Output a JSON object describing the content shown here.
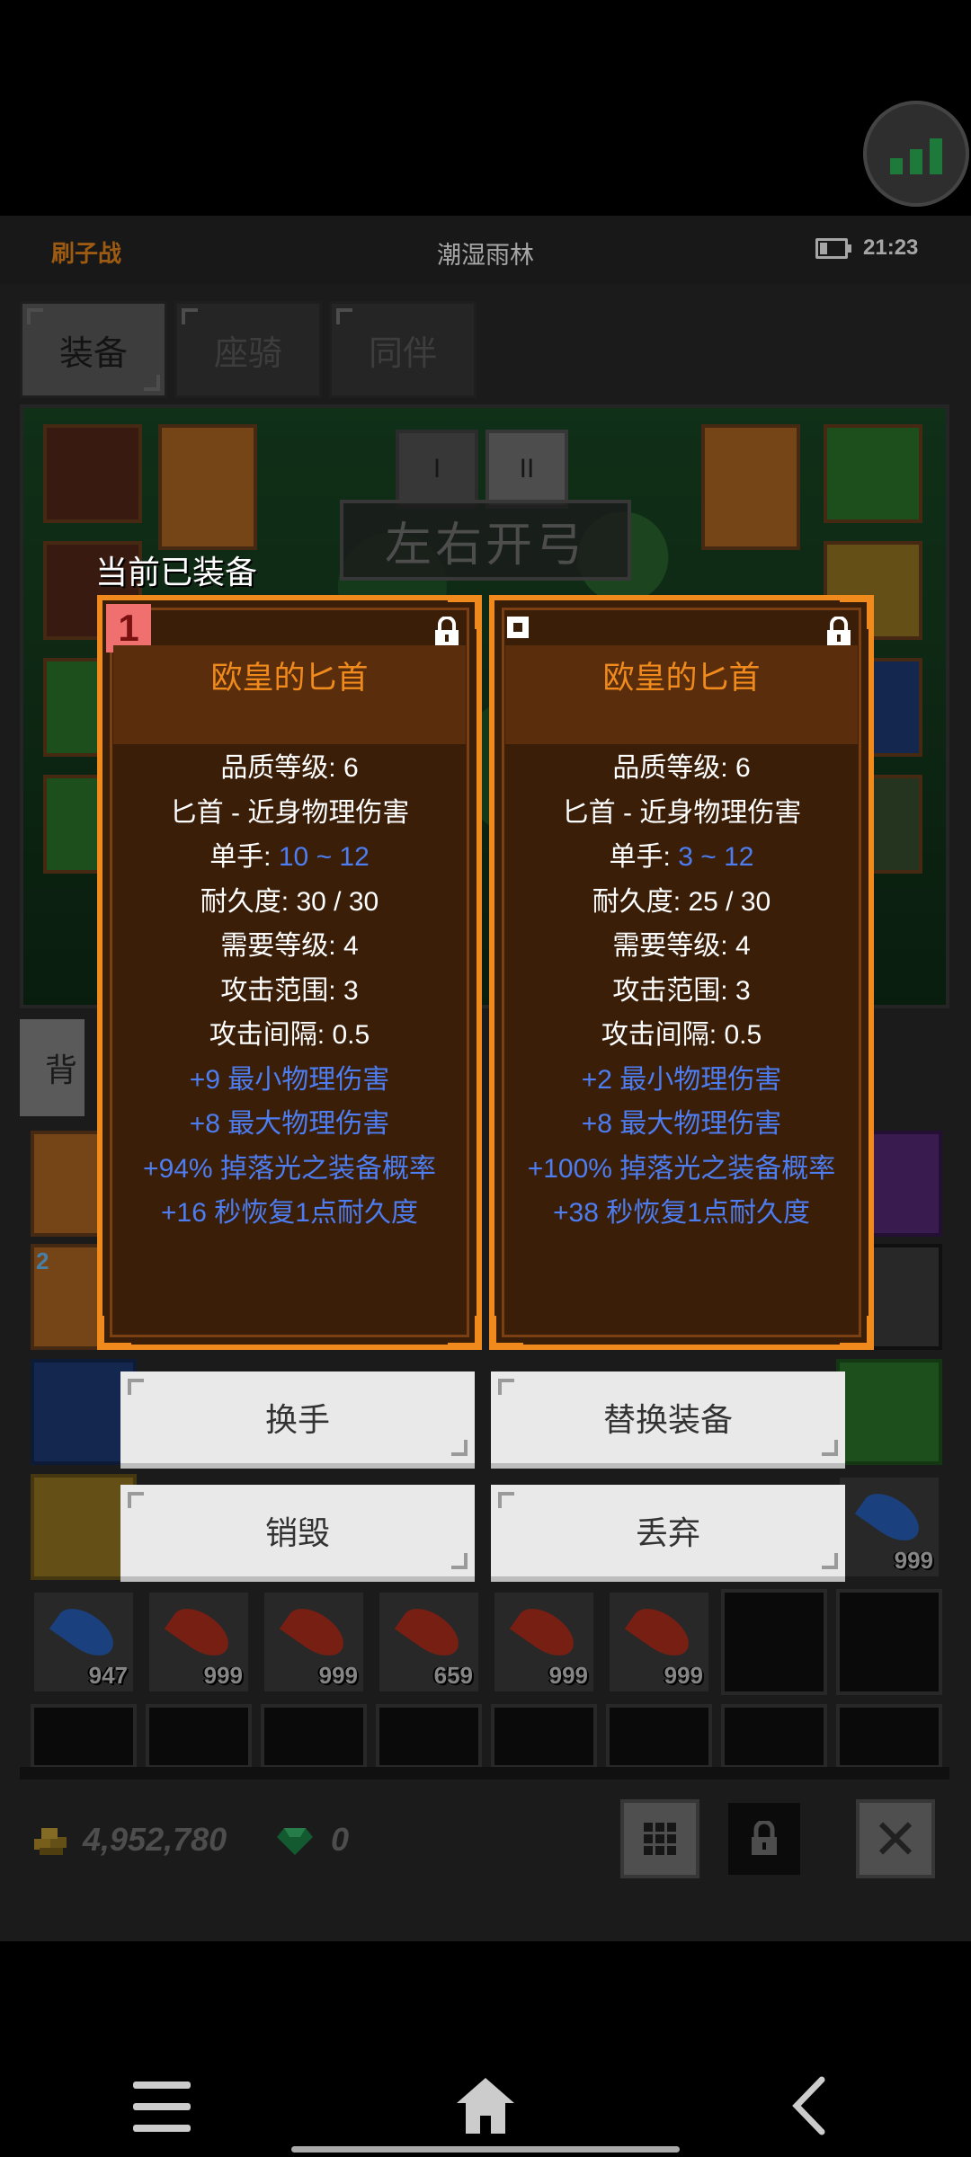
{
  "status_bar": {
    "left_label": "刷子战",
    "map_name": "潮湿雨林",
    "time": "21:23"
  },
  "tabs": [
    {
      "label": "装备",
      "active": true
    },
    {
      "label": "座骑",
      "active": false
    },
    {
      "label": "同伴",
      "active": false
    }
  ],
  "equip_panel": {
    "mode_buttons": [
      "I",
      "II"
    ],
    "bow_mode_label": "左右开弓"
  },
  "bag_tab_label": "背",
  "current_equipped_label": "当前已装备",
  "cards": [
    {
      "badge": "1",
      "name": "欧皇的匕首",
      "quality_level": "品质等级: 6",
      "type_line": "匕首 - 近身物理伤害",
      "damage_label": "单手: ",
      "damage_value": "10 ~ 12",
      "durability": "耐久度: 30 / 30",
      "required_level": "需要等级: 4",
      "attack_range": "攻击范围: 3",
      "attack_interval": "攻击间隔: 0.5",
      "affixes": [
        "+9 最小物理伤害",
        "+8 最大物理伤害",
        "+94% 掉落光之装备概率",
        "+16 秒恢复1点耐久度"
      ]
    },
    {
      "badge": "",
      "name": "欧皇的匕首",
      "quality_level": "品质等级: 6",
      "type_line": "匕首 - 近身物理伤害",
      "damage_label": "单手: ",
      "damage_value": "3 ~ 12",
      "durability": "耐久度: 25 / 30",
      "required_level": "需要等级: 4",
      "attack_range": "攻击范围: 3",
      "attack_interval": "攻击间隔: 0.5",
      "affixes": [
        "+2 最小物理伤害",
        "+8 最大物理伤害",
        "+100% 掉落光之装备概率",
        "+38 秒恢复1点耐久度"
      ]
    }
  ],
  "actions": {
    "swap_hand": "换手",
    "replace_equipment": "替换装备",
    "destroy": "销毁",
    "discard": "丢弃"
  },
  "inventory": {
    "row_counts": [
      "947",
      "999",
      "999",
      "659",
      "999",
      "999"
    ],
    "right_count": "999",
    "left_badge": "2"
  },
  "currency": {
    "gold": "4,952,780",
    "gems": "0"
  },
  "colors": {
    "accent": "#f08a1d",
    "affix_blue": "#4d7df0",
    "card_bg": "#3a1e08"
  },
  "icons": [
    "signal-icon",
    "battery-icon",
    "lock-icon",
    "grid-icon",
    "close-icon",
    "gold-icon",
    "gem-icon",
    "menu-icon",
    "home-icon",
    "back-icon"
  ]
}
